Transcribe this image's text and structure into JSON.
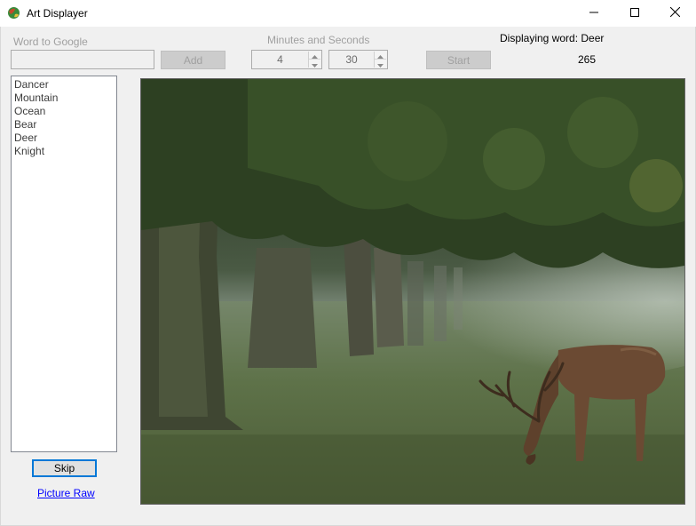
{
  "window": {
    "title": "Art Displayer",
    "app_icon": "globe-palette-icon",
    "minimize_icon": "minimize-icon",
    "maximize_icon": "maximize-icon",
    "close_icon": "close-icon"
  },
  "controls": {
    "word_label": "Word to Google",
    "word_input_value": "",
    "add_label": "Add",
    "minsec_label": "Minutes and Seconds",
    "minutes_value": "4",
    "seconds_value": "30",
    "start_label": "Start",
    "displaying_label": "Displaying word: Deer",
    "counter_value": "265"
  },
  "words": [
    "Dancer",
    "Mountain",
    "Ocean",
    "Bear",
    "Deer",
    "Knight"
  ],
  "bottom": {
    "skip_label": "Skip",
    "picture_raw_label": "Picture Raw"
  },
  "picture": {
    "subject": "deer-grazing-under-trees",
    "colors": {
      "grass": "#5b6d45",
      "canopy": "#2f4424",
      "mist": "#a9b2a6",
      "deer": "#6b4a33"
    }
  },
  "colors": {
    "window_bg": "#f0f0f0",
    "focus_border": "#0078d7",
    "link": "#0000ff",
    "disabled_text": "#a0a0a0"
  }
}
